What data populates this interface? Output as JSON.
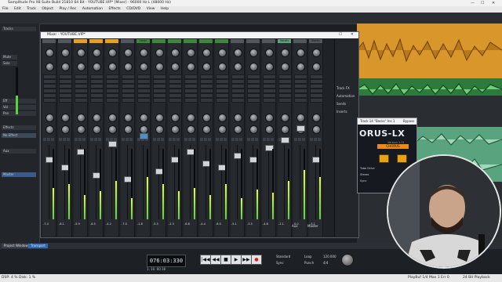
{
  "app": {
    "title": "SamplItude Pro X8 Suite Build 21810 64 Bit - YOUTUBE.VIP* [Mixer] - 96000 Hz L (48000 Hz)",
    "menu": [
      "File",
      "Edit",
      "Track",
      "Object",
      "Play / Rec",
      "Automation",
      "Effects",
      "CD/DVD",
      "View",
      "Help"
    ]
  },
  "left_panel": {
    "rows": [
      "Tracks",
      "Mute",
      "Solo",
      "Eff",
      "Vol",
      "Pan",
      "Effects",
      "No Effect",
      "Aux",
      "Master"
    ]
  },
  "mixer": {
    "title": "Mixer - YOUTUBE.VIP*",
    "strip_names": [
      "",
      "",
      "",
      "",
      "",
      "",
      "Lead",
      "",
      "",
      "",
      "",
      "",
      "",
      "",
      "",
      "Vocals",
      "",
      "Backs"
    ],
    "strip_values": [
      "-7.4",
      "-6.1",
      "-5.9",
      "-6.5",
      "-4.2",
      "-7.0",
      "-1.8",
      "-5.5",
      "-2.3",
      "-6.8",
      "-4.4",
      "-6.0",
      "-5.1",
      "-3.5",
      "-4.8",
      "-2.1",
      "0.0",
      "-3.1"
    ],
    "master_label": "Master",
    "aux_label": "Aux",
    "side_labels": [
      "Track FX",
      "Automation",
      "Sends",
      "Inserts"
    ]
  },
  "plugin": {
    "title": "Track 14 \"Backs\" Ins 1",
    "bypass_label": "Bypass",
    "name": "ORUS-LX",
    "version": "Version 1.01",
    "chorus_label": "CHORUS",
    "option_labels": [
      "Tube Drive",
      "Stereo",
      "Sync"
    ]
  },
  "bottom_tabs": [
    "Project Window",
    "Transport"
  ],
  "transport": {
    "timecode": "076:03:330",
    "position": "1. 10. 60.16",
    "buttons": [
      "|◀◀",
      "◀◀",
      "■",
      "▶",
      "▶▶",
      "●"
    ],
    "standard_label": "Standard",
    "sync_label": "Sync",
    "tempo": "120.000",
    "signature": "4/4",
    "loop_label": "Loop",
    "punch_label": "Punch"
  },
  "status_bar": {
    "left": "DSP: 4 %   Disk: 1 %",
    "middle": "PlayBuf 1/4  Max 1  Err 0",
    "right": "24 Bit Playback"
  },
  "colors": {
    "accent_orange": "#e8a020",
    "track_green": "#3a8a3a",
    "track_teal": "#5aa37f",
    "meter_green": "#5ad43a"
  }
}
